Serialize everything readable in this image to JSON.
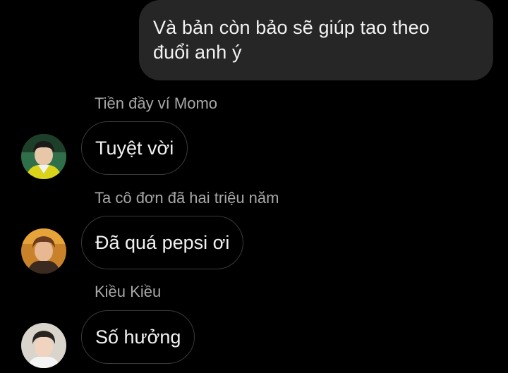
{
  "outgoing": {
    "text": "Và bản còn bảo sẽ giúp tao theo\nđuổi anh ý"
  },
  "messages": [
    {
      "sender": "Tiền đầy ví Momo",
      "text": "Tuyệt vời",
      "avatar": "avatar-boy-green-jacket"
    },
    {
      "sender": "Ta cô đơn đã hai triệu năm",
      "text": "Đã quá pepsi ơi",
      "avatar": "avatar-boy-orange-bg"
    },
    {
      "sender": "Kiều Kiều",
      "text": "Số hưởng",
      "avatar": "avatar-boy-light-bg"
    }
  ],
  "colors": {
    "background": "#000000",
    "outgoing_bubble": "#262626",
    "incoming_bubble_border": "#3a3a3a",
    "sender_name": "#a8a8a8",
    "message_text": "#f2f2f2"
  }
}
